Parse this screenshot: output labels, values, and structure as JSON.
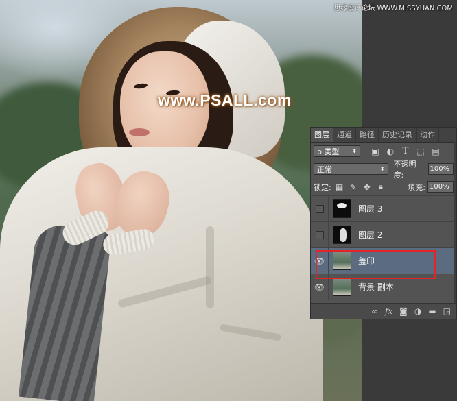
{
  "watermark": {
    "top_right": "思缘设计论坛 WWW.MISSYUAN.COM",
    "center": "www.PSALL.com"
  },
  "panel": {
    "tabs": [
      "图层",
      "通道",
      "路径",
      "历史记录",
      "动作"
    ],
    "active_tab": "图层",
    "filter": {
      "label": "ρ 类型",
      "icons": [
        "image-filter-icon",
        "adjustment-filter-icon",
        "type-filter-icon",
        "shape-filter-icon",
        "smart-object-filter-icon"
      ]
    },
    "blend_mode": "正常",
    "opacity": {
      "label": "不透明度:",
      "value": "100%"
    },
    "lock": {
      "label": "锁定:"
    },
    "fill": {
      "label": "填充:",
      "value": "100%"
    },
    "layers": [
      {
        "name": "图层 3",
        "visible": false,
        "thumb": "dark"
      },
      {
        "name": "图层 2",
        "visible": false,
        "thumb": "dark"
      },
      {
        "name": "盖印",
        "visible": true,
        "selected": true,
        "thumb": "photo"
      },
      {
        "name": "背景 副本",
        "visible": true,
        "thumb": "photo"
      }
    ],
    "footer_icons": [
      "link-icon",
      "fx-icon",
      "mask-icon",
      "adjustment-icon",
      "folder-icon",
      "new-layer-icon"
    ]
  },
  "colors": {
    "selection": "#5b6b80",
    "highlight_border": "#e2232a",
    "panel_bg": "#535353"
  }
}
